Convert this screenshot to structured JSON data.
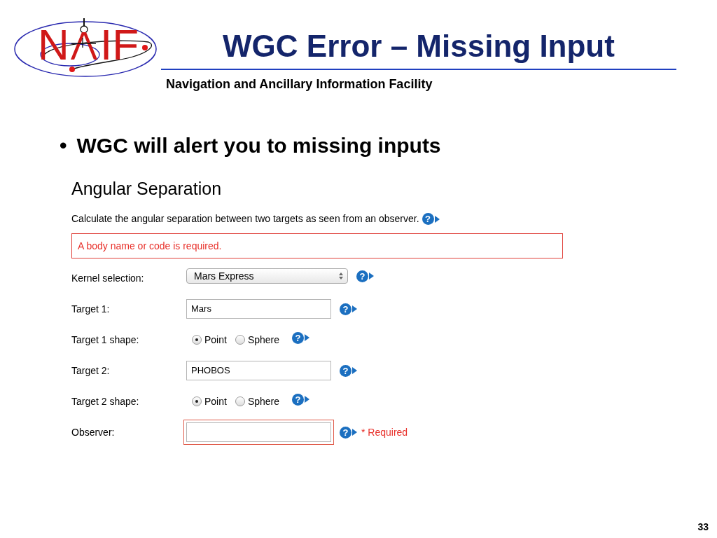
{
  "logo": {
    "letters": [
      "N",
      "IF"
    ]
  },
  "title": "WGC Error – Missing Input",
  "subtitle": "Navigation and Ancillary Information Facility",
  "bullets": [
    {
      "mark": "•",
      "text": "WGC will alert you to missing inputs"
    }
  ],
  "form": {
    "heading": "Angular Separation",
    "description": "Calculate the angular separation between two targets as seen from an observer.",
    "description_help": "?",
    "error": "A body name or code is required.",
    "fields": [
      {
        "kind": "select",
        "label": "Kernel selection:",
        "value": "Mars Express",
        "help": "?"
      },
      {
        "kind": "text",
        "label": "Target 1:",
        "value": "Mars",
        "invalid": false,
        "help": "?"
      },
      {
        "kind": "radio",
        "label": "Target 1 shape:",
        "options": [
          {
            "label": "Point",
            "selected": true
          },
          {
            "label": "Sphere",
            "selected": false
          }
        ],
        "help": "?"
      },
      {
        "kind": "text",
        "label": "Target 2:",
        "value": "PHOBOS",
        "invalid": false,
        "help": "?"
      },
      {
        "kind": "radio",
        "label": "Target 2 shape:",
        "options": [
          {
            "label": "Point",
            "selected": true
          },
          {
            "label": "Sphere",
            "selected": false
          }
        ],
        "help": "?"
      },
      {
        "kind": "text",
        "label": "Observer:",
        "invalid": true,
        "help": "?",
        "note": "* Required"
      }
    ]
  },
  "page_number": "33"
}
